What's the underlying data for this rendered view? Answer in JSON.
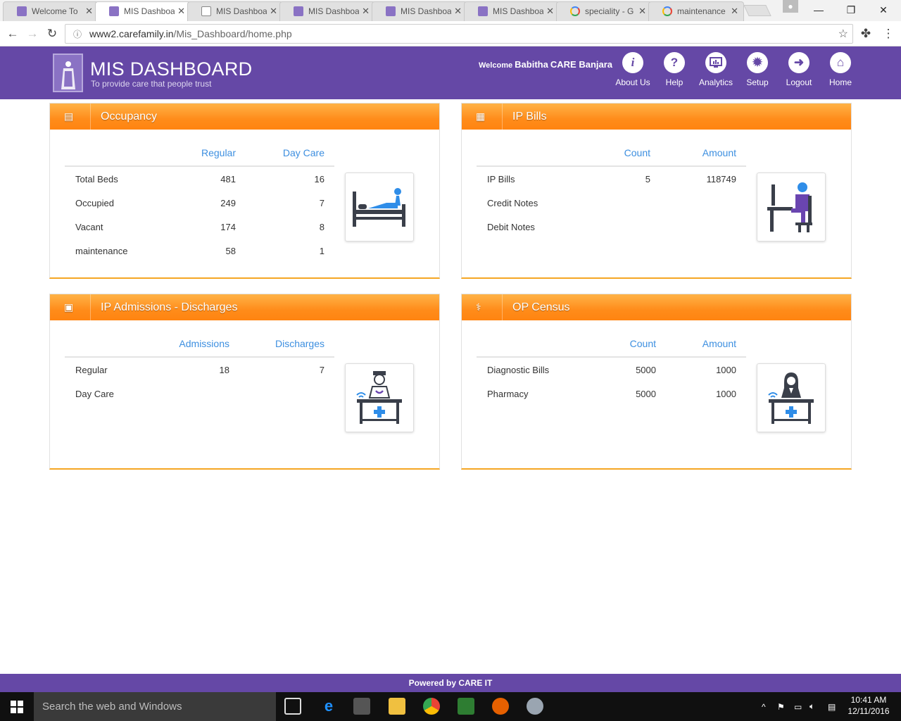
{
  "browser": {
    "tabs": [
      {
        "title": "Welcome To",
        "favicon": "care-logo-icon"
      },
      {
        "title": "MIS Dashboa",
        "favicon": "care-logo-icon",
        "active": true
      },
      {
        "title": "MIS Dashboa",
        "favicon": "document-icon"
      },
      {
        "title": "MIS Dashboa",
        "favicon": "care-logo-icon"
      },
      {
        "title": "MIS Dashboa",
        "favicon": "care-logo-icon"
      },
      {
        "title": "MIS Dashboa",
        "favicon": "care-logo-icon"
      },
      {
        "title": "speciality - G",
        "favicon": "google-icon"
      },
      {
        "title": "maintenance",
        "favicon": "google-icon"
      }
    ],
    "url_host": "www2.carefamily.in",
    "url_path": "/Mis_Dashboard/home.php"
  },
  "header": {
    "title": "MIS DASHBOARD",
    "tagline": "To provide care that people trust",
    "welcome_prefix": "Welcome",
    "welcome_name": "Babitha",
    "welcome_location": "CARE Banjara",
    "nav": [
      {
        "label": "About Us",
        "icon": "info-icon",
        "glyph": "i"
      },
      {
        "label": "Help",
        "icon": "help-icon",
        "glyph": "?"
      },
      {
        "label": "Analytics",
        "icon": "analytics-icon",
        "glyph": "▣"
      },
      {
        "label": "Setup",
        "icon": "gear-icon",
        "glyph": "✹"
      },
      {
        "label": "Logout",
        "icon": "logout-icon",
        "glyph": "➜"
      },
      {
        "label": "Home",
        "icon": "home-icon",
        "glyph": "⌂"
      }
    ]
  },
  "panels": {
    "occupancy": {
      "title": "Occupancy",
      "cols": [
        "Regular",
        "Day Care"
      ],
      "rows": [
        {
          "label": "Total Beds",
          "v1": "481",
          "v2": "16"
        },
        {
          "label": "Occupied",
          "v1": "249",
          "v2": "7"
        },
        {
          "label": "Vacant",
          "v1": "174",
          "v2": "8"
        },
        {
          "label": "maintenance",
          "v1": "58",
          "v2": "1"
        }
      ]
    },
    "ipbills": {
      "title": "IP Bills",
      "cols": [
        "Count",
        "Amount"
      ],
      "rows": [
        {
          "label": "IP Bills",
          "v1": "5",
          "v2": "118749"
        },
        {
          "label": "Credit Notes",
          "v1": "",
          "v2": ""
        },
        {
          "label": "Debit Notes",
          "v1": "",
          "v2": ""
        }
      ]
    },
    "admissions": {
      "title": "IP Admissions - Discharges",
      "cols": [
        "Admissions",
        "Discharges"
      ],
      "rows": [
        {
          "label": "Regular",
          "v1": "18",
          "v2": "7"
        },
        {
          "label": "Day Care",
          "v1": "",
          "v2": ""
        }
      ]
    },
    "opcensus": {
      "title": "OP Census",
      "cols": [
        "Count",
        "Amount"
      ],
      "rows": [
        {
          "label": "Diagnostic Bills",
          "v1": "5000",
          "v2": "1000"
        },
        {
          "label": "Pharmacy",
          "v1": "5000",
          "v2": "1000"
        }
      ]
    }
  },
  "footer": {
    "text": "Powered by CARE IT"
  },
  "taskbar": {
    "search_placeholder": "Search the web and Windows",
    "time": "10:41 AM",
    "date": "12/11/2016"
  },
  "colors": {
    "brand": "#6548a6",
    "panel_header": "#ff8c1a",
    "column_header": "#3d8fe0"
  }
}
